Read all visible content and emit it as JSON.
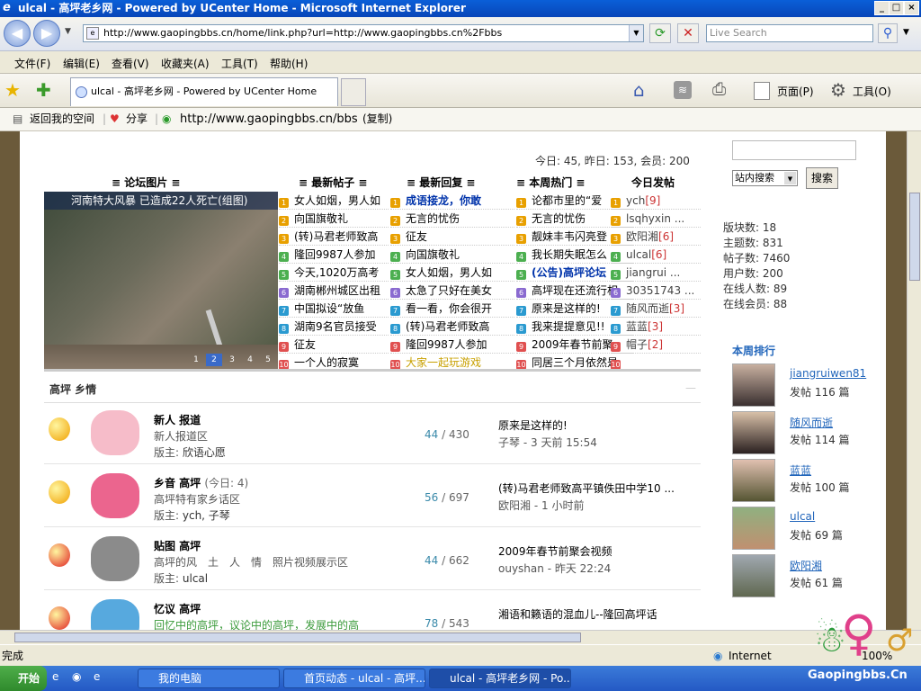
{
  "window": {
    "title": "ulcal - 高坪老乡网 - Powered by UCenter Home - Microsoft Internet Explorer"
  },
  "address": {
    "url": "http://www.gaopingbbs.cn/home/link.php?url=http://www.gaopingbbs.cn%2Fbbs",
    "search_placeholder": "Live Search"
  },
  "menu": [
    "文件(F)",
    "编辑(E)",
    "查看(V)",
    "收藏夹(A)",
    "工具(T)",
    "帮助(H)"
  ],
  "tab": {
    "label": "ulcal - 高坪老乡网 - Powered by UCenter Home"
  },
  "cmdbar": {
    "page": "页面(P)",
    "tools": "工具(O)"
  },
  "links": {
    "back": "返回我的空间",
    "share": "分享",
    "link_url": "http://www.gaopingbbs.cn/bbs",
    "copy": "(复制)"
  },
  "stats_top": "今日: 45, 昨日: 153, 会员: 200",
  "columns": {
    "pics": "≡ 论坛图片 ≡",
    "latest": "≡ 最新帖子 ≡",
    "replies": "≡ 最新回复 ≡",
    "hot": "≡ 本周热门 ≡",
    "today": "今日发帖"
  },
  "slide": {
    "caption": "河南特大风暴 已造成22人死亡(组图)",
    "pages": [
      "1",
      "2",
      "3",
      "4",
      "5"
    ]
  },
  "latest": [
    "女人如烟，男人如",
    "向国旗敬礼",
    "(转)马君老师致高",
    "隆回9987人参加",
    "今天,1020万高考",
    "湖南郴州城区出租",
    "中国拟设“放鱼",
    "湖南9名官员接受",
    "征友",
    "一个人的寂寞"
  ],
  "replies": [
    "成语接龙，你敢",
    "无言的忧伤",
    "征友",
    "向国旗敬礼",
    "女人如烟，男人如",
    "太急了只好在美女",
    "看一看，你会很开",
    "(转)马君老师致高",
    "隆回9987人参加",
    "大家一起玩游戏"
  ],
  "hot": [
    "论都市里的“爱",
    "无言的忧伤",
    "靓妹丰韦闪亮登",
    "我长期失眠怎么",
    "(公告)高坪论坛",
    "高坪现在还流行相",
    "原来是这样的!",
    "我来提提意见!!",
    "2009年春节前聚",
    "同居三个月依然是"
  ],
  "today": [
    {
      "n": "ych",
      "c": "[9]"
    },
    {
      "n": "lsqhyxin ...",
      "c": ""
    },
    {
      "n": "欧阳湘",
      "c": "[6]"
    },
    {
      "n": "ulcal",
      "c": "[6]"
    },
    {
      "n": "jiangrui ...",
      "c": ""
    },
    {
      "n": "30351743 ...",
      "c": ""
    },
    {
      "n": "随风而逝",
      "c": "[3]"
    },
    {
      "n": "蓝蓝",
      "c": "[3]"
    },
    {
      "n": "帽子",
      "c": "[2]"
    }
  ],
  "section": "高坪 乡情",
  "forums": [
    {
      "name": "新人 报道",
      "today": "",
      "desc": "新人报道区",
      "mod_label": "版主:",
      "mod": "欣语心愿",
      "threads": "44",
      "posts": "/ 430",
      "last": "原来是这样的!",
      "by": "子琴",
      "time": "- 3 天前 15:54"
    },
    {
      "name": "乡音 高坪",
      "today": "(今日: 4)",
      "desc": "高坪特有家乡话区",
      "mod_label": "版主:",
      "mod": "ych, 子琴",
      "threads": "56",
      "posts": "/ 697",
      "last": "(转)马君老师致高平镇佚田中学10 ...",
      "by": "欧阳湘",
      "time": "- 1 小时前"
    },
    {
      "name": "贴图 高坪",
      "today": "",
      "desc": "高坪的风　土　人　情　照片视频展示区",
      "mod_label": "版主:",
      "mod": "ulcal",
      "threads": "44",
      "posts": "/ 662",
      "last": "2009年春节前聚会视频",
      "by": "ouyshan",
      "time": "- 昨天 22:24"
    },
    {
      "name": "忆议 高坪",
      "today": "",
      "desc": "回忆中的高坪，议论中的高坪，发展中的高",
      "mod_label": "",
      "mod": "",
      "threads": "78",
      "posts": "/ 543",
      "last": "湘语和籁语的混血儿--隆回高坪话",
      "by": "",
      "time": ""
    }
  ],
  "side": {
    "search_btn": "搜索",
    "select": "站内搜索",
    "stats": [
      "版块数: 18",
      "主题数: 831",
      "帖子数: 7460",
      "用户数: 200",
      "在线人数: 89",
      "在线会员: 88"
    ],
    "rank_title": "本周排行",
    "ranks": [
      {
        "name": "jiangruiwen81",
        "posts": "发帖 116 篇"
      },
      {
        "name": "随风而逝",
        "posts": "发帖 114 篇"
      },
      {
        "name": "蓝蓝",
        "posts": "发帖 100 篇"
      },
      {
        "name": "ulcal",
        "posts": "发帖 69 篇"
      },
      {
        "name": "欧阳湘",
        "posts": "发帖 61 篇"
      }
    ]
  },
  "status": {
    "left": "完成",
    "zone": "Internet",
    "zoom": "100%",
    "watermark": "Gaopingbbs.Cn"
  },
  "taskbar": {
    "start": "开始",
    "items": [
      "我的电脑",
      "首页动态 - ulcal - 高坪...",
      "ulcal - 高坪老乡网 - Po..."
    ]
  },
  "colors": {
    "link": "#2266bb",
    "red": "#cc3333",
    "green": "#33aa33",
    "hot": "#cc8800"
  }
}
